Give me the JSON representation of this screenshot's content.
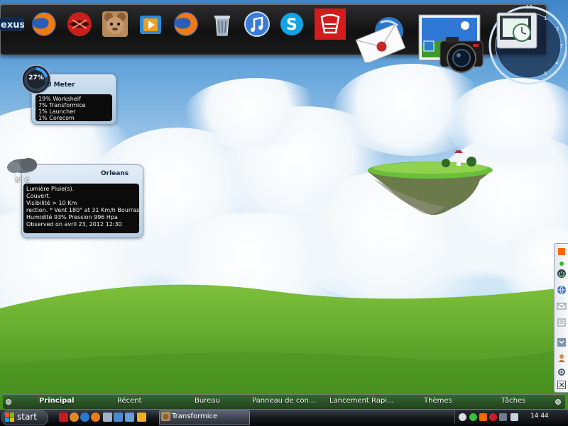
{
  "dock": {
    "icons": [
      "nexus-icon",
      "firefox-icon",
      "red-app-icon",
      "transformice-icon",
      "media-player-icon",
      "firefox-icon",
      "recycle-bin-icon",
      "itunes-icon",
      "skype-icon",
      "caisse-epargne-icon",
      "mail-icon",
      "photo-viewer-icon",
      "camera-icon",
      "clock-widget-icon"
    ],
    "nexus_text": "exus"
  },
  "cpu_meter": {
    "title": "CPU Meter",
    "percent": "27%",
    "processes": [
      "19% Workshelf",
      "7% Transformice",
      "1% Launcher",
      "1% Corecom"
    ]
  },
  "weather": {
    "city": "Orleans",
    "temp": "8° C",
    "lines": [
      "Lumière Pluie(s).",
      "Couvert.",
      "Visibilité  > 10 Km",
      " rection. * Vent 180° at 31 Km/h Bourras",
      "Humidité  93%       Pression  996 Hpa",
      "Observed on avril 23, 2012 12:30"
    ]
  },
  "menu_bar": {
    "items": [
      {
        "label": "Principal",
        "active": true
      },
      {
        "label": "Récent",
        "active": false
      },
      {
        "label": "Bureau",
        "active": false
      },
      {
        "label": "Panneau de con...",
        "active": false
      },
      {
        "label": "Lancement Rapi...",
        "active": false
      },
      {
        "label": "Thèmes",
        "active": false
      },
      {
        "label": "Tâches",
        "active": false
      }
    ]
  },
  "taskbar": {
    "start_label": "start",
    "task_label": "Transformice",
    "clock": "14 44"
  },
  "colors": {
    "accent_orange": "#ff6600",
    "dock_dark": "#111111",
    "sky_blue": "#3f86c8",
    "grass_green": "#5aa12a"
  }
}
